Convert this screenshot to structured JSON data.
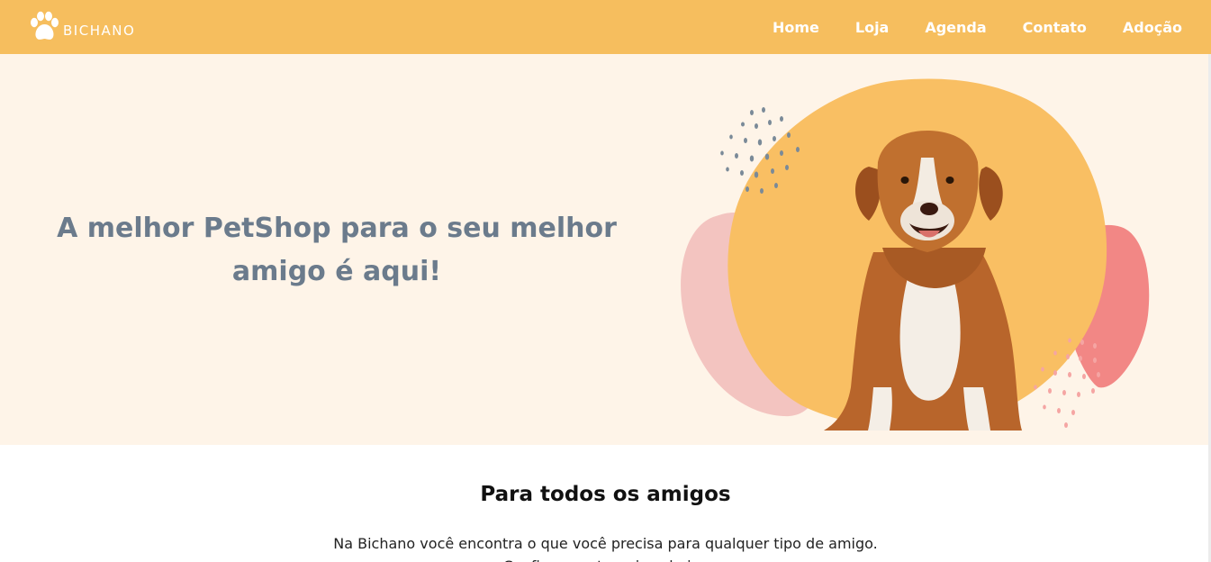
{
  "brand": {
    "name": "BICHANO",
    "logo_icon": "paw-icon"
  },
  "nav": {
    "items": [
      {
        "label": "Home"
      },
      {
        "label": "Loja"
      },
      {
        "label": "Agenda"
      },
      {
        "label": "Contato"
      },
      {
        "label": "Adoção"
      }
    ]
  },
  "hero": {
    "title": "A melhor PetShop para o seu melhor amigo é aqui!",
    "image": "dog-photo"
  },
  "section": {
    "title": "Para todos os amigos",
    "line1": "Na Bichano você encontra o que você precisa para qualquer tipo de amigo.",
    "line2": "Confira as categorias abaixo"
  },
  "colors": {
    "navbar": "#F6BE5E",
    "hero_bg": "#FEF4E8",
    "hero_text": "#6B7B8C",
    "blob_yellow": "#F9BF63",
    "blob_pink": "#F28785",
    "blob_light_pink": "#F3C4C0"
  }
}
